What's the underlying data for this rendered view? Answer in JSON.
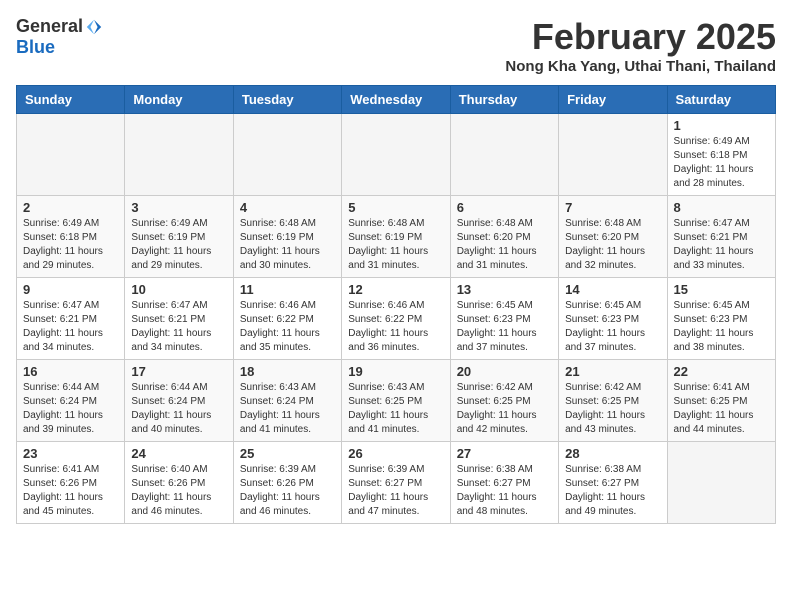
{
  "logo": {
    "general": "General",
    "blue": "Blue"
  },
  "title": "February 2025",
  "subtitle": "Nong Kha Yang, Uthai Thani, Thailand",
  "days_of_week": [
    "Sunday",
    "Monday",
    "Tuesday",
    "Wednesday",
    "Thursday",
    "Friday",
    "Saturday"
  ],
  "weeks": [
    [
      {
        "day": "",
        "info": ""
      },
      {
        "day": "",
        "info": ""
      },
      {
        "day": "",
        "info": ""
      },
      {
        "day": "",
        "info": ""
      },
      {
        "day": "",
        "info": ""
      },
      {
        "day": "",
        "info": ""
      },
      {
        "day": "1",
        "info": "Sunrise: 6:49 AM\nSunset: 6:18 PM\nDaylight: 11 hours and 28 minutes."
      }
    ],
    [
      {
        "day": "2",
        "info": "Sunrise: 6:49 AM\nSunset: 6:18 PM\nDaylight: 11 hours and 29 minutes."
      },
      {
        "day": "3",
        "info": "Sunrise: 6:49 AM\nSunset: 6:19 PM\nDaylight: 11 hours and 29 minutes."
      },
      {
        "day": "4",
        "info": "Sunrise: 6:48 AM\nSunset: 6:19 PM\nDaylight: 11 hours and 30 minutes."
      },
      {
        "day": "5",
        "info": "Sunrise: 6:48 AM\nSunset: 6:19 PM\nDaylight: 11 hours and 31 minutes."
      },
      {
        "day": "6",
        "info": "Sunrise: 6:48 AM\nSunset: 6:20 PM\nDaylight: 11 hours and 31 minutes."
      },
      {
        "day": "7",
        "info": "Sunrise: 6:48 AM\nSunset: 6:20 PM\nDaylight: 11 hours and 32 minutes."
      },
      {
        "day": "8",
        "info": "Sunrise: 6:47 AM\nSunset: 6:21 PM\nDaylight: 11 hours and 33 minutes."
      }
    ],
    [
      {
        "day": "9",
        "info": "Sunrise: 6:47 AM\nSunset: 6:21 PM\nDaylight: 11 hours and 34 minutes."
      },
      {
        "day": "10",
        "info": "Sunrise: 6:47 AM\nSunset: 6:21 PM\nDaylight: 11 hours and 34 minutes."
      },
      {
        "day": "11",
        "info": "Sunrise: 6:46 AM\nSunset: 6:22 PM\nDaylight: 11 hours and 35 minutes."
      },
      {
        "day": "12",
        "info": "Sunrise: 6:46 AM\nSunset: 6:22 PM\nDaylight: 11 hours and 36 minutes."
      },
      {
        "day": "13",
        "info": "Sunrise: 6:45 AM\nSunset: 6:23 PM\nDaylight: 11 hours and 37 minutes."
      },
      {
        "day": "14",
        "info": "Sunrise: 6:45 AM\nSunset: 6:23 PM\nDaylight: 11 hours and 37 minutes."
      },
      {
        "day": "15",
        "info": "Sunrise: 6:45 AM\nSunset: 6:23 PM\nDaylight: 11 hours and 38 minutes."
      }
    ],
    [
      {
        "day": "16",
        "info": "Sunrise: 6:44 AM\nSunset: 6:24 PM\nDaylight: 11 hours and 39 minutes."
      },
      {
        "day": "17",
        "info": "Sunrise: 6:44 AM\nSunset: 6:24 PM\nDaylight: 11 hours and 40 minutes."
      },
      {
        "day": "18",
        "info": "Sunrise: 6:43 AM\nSunset: 6:24 PM\nDaylight: 11 hours and 41 minutes."
      },
      {
        "day": "19",
        "info": "Sunrise: 6:43 AM\nSunset: 6:25 PM\nDaylight: 11 hours and 41 minutes."
      },
      {
        "day": "20",
        "info": "Sunrise: 6:42 AM\nSunset: 6:25 PM\nDaylight: 11 hours and 42 minutes."
      },
      {
        "day": "21",
        "info": "Sunrise: 6:42 AM\nSunset: 6:25 PM\nDaylight: 11 hours and 43 minutes."
      },
      {
        "day": "22",
        "info": "Sunrise: 6:41 AM\nSunset: 6:25 PM\nDaylight: 11 hours and 44 minutes."
      }
    ],
    [
      {
        "day": "23",
        "info": "Sunrise: 6:41 AM\nSunset: 6:26 PM\nDaylight: 11 hours and 45 minutes."
      },
      {
        "day": "24",
        "info": "Sunrise: 6:40 AM\nSunset: 6:26 PM\nDaylight: 11 hours and 46 minutes."
      },
      {
        "day": "25",
        "info": "Sunrise: 6:39 AM\nSunset: 6:26 PM\nDaylight: 11 hours and 46 minutes."
      },
      {
        "day": "26",
        "info": "Sunrise: 6:39 AM\nSunset: 6:27 PM\nDaylight: 11 hours and 47 minutes."
      },
      {
        "day": "27",
        "info": "Sunrise: 6:38 AM\nSunset: 6:27 PM\nDaylight: 11 hours and 48 minutes."
      },
      {
        "day": "28",
        "info": "Sunrise: 6:38 AM\nSunset: 6:27 PM\nDaylight: 11 hours and 49 minutes."
      },
      {
        "day": "",
        "info": ""
      }
    ]
  ]
}
